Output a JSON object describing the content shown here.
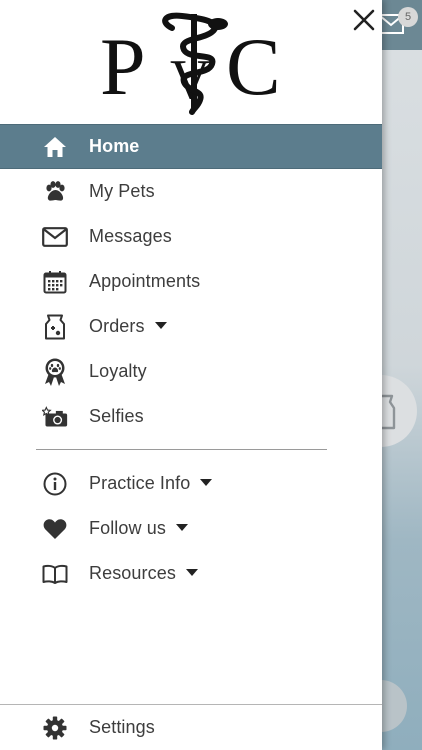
{
  "background": {
    "message_badge": "5"
  },
  "drawer": {
    "logo_text": "PVC",
    "menu": [
      {
        "label": "Home",
        "icon": "home-icon",
        "active": true
      },
      {
        "label": "My Pets",
        "icon": "paw-icon"
      },
      {
        "label": "Messages",
        "icon": "envelope-icon"
      },
      {
        "label": "Appointments",
        "icon": "calendar-icon"
      },
      {
        "label": "Orders",
        "icon": "pet-food-bag-icon",
        "has_dropdown": true
      },
      {
        "label": "Loyalty",
        "icon": "award-ribbon-icon"
      },
      {
        "label": "Selfies",
        "icon": "camera-star-icon"
      }
    ],
    "secondary_menu": [
      {
        "label": "Practice Info",
        "icon": "info-icon",
        "has_dropdown": true
      },
      {
        "label": "Follow us",
        "icon": "heart-icon",
        "has_dropdown": true
      },
      {
        "label": "Resources",
        "icon": "book-icon",
        "has_dropdown": true
      }
    ],
    "footer": {
      "label": "Settings",
      "icon": "gear-icon"
    }
  },
  "colors": {
    "active_item_bg": "#5c7d8d",
    "icon_color": "#333333",
    "label_color": "#3d3d3d"
  }
}
